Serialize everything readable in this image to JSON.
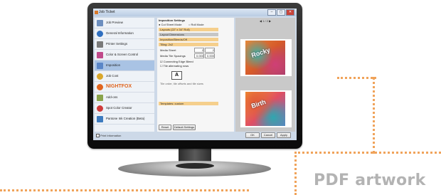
{
  "window": {
    "title": "Job Ticket",
    "buttons": [
      "–",
      "▢",
      "✕"
    ]
  },
  "sidebar": {
    "items": [
      {
        "label": "Job Preview",
        "icon": "document-icon",
        "color": "#6d8fbf"
      },
      {
        "label": "General Information",
        "icon": "info-icon",
        "color": "#2f6fc0"
      },
      {
        "label": "Printer Settings",
        "icon": "printer-icon",
        "color": "#7a7a7a"
      },
      {
        "label": "Color & Screen Control",
        "icon": "color-icon",
        "color": "#c04a8a"
      },
      {
        "label": "Imposition",
        "icon": "layout-icon",
        "color": "#5a86c7",
        "active": true
      },
      {
        "label": "Job Cost",
        "icon": "coins-icon",
        "color": "#d9a72b"
      },
      {
        "label": "NIGHTFOX",
        "icon": "nightfox-logo-icon",
        "color": "#e0651f"
      },
      {
        "label": "Add-ons",
        "icon": "puzzle-icon",
        "color": "#8aa44b"
      },
      {
        "label": "Spot Color Creator",
        "icon": "spot-color-icon",
        "color": "#cf3b3b"
      },
      {
        "label": "Pantone Ink Creation (Beta)",
        "icon": "ink-icon",
        "color": "#3d7bbf"
      }
    ],
    "footer": "Print Information"
  },
  "panel": {
    "heading": "Imposition Settings",
    "radios": [
      "Cut Sheet Mode",
      "Roll Mode"
    ],
    "bar1": "Layouts (22\" x 34\" Roll)",
    "bar2": "Layout Dimensions",
    "bar3": "Imposition/Bleeds/Off",
    "bar4": "Tiling: 2x2",
    "labels": {
      "media_sheet": "Media Sheet",
      "media_spacing": "Media Tile Spacings",
      "connect": "Connecting Edge Bleed",
      "tile_alternate": "Tile alternating rows",
      "templates": "Templates: custom"
    },
    "values": {
      "sheet_a": "2",
      "sheet_b": "2",
      "spacing_a": "0.000",
      "spacing_b": "0.000"
    },
    "note": "Tile order, tile offsets and tile sizes",
    "buttons": {
      "reset": "Reset",
      "default": "Default Settings"
    }
  },
  "preview": {
    "pager": "◀ 1 / 2 ▶",
    "art_text_1": "Rocky",
    "art_text_2": "Birth"
  },
  "actions": {
    "ok": "OK",
    "cancel": "Cancel",
    "apply": "Apply"
  },
  "callout": "PDF artwork",
  "colors": {
    "accent_dots": "#f0a35a",
    "callout_text": "#b3b3b3",
    "selected_row": "#a9c3e4",
    "section_bar": "#f5cf8c"
  }
}
